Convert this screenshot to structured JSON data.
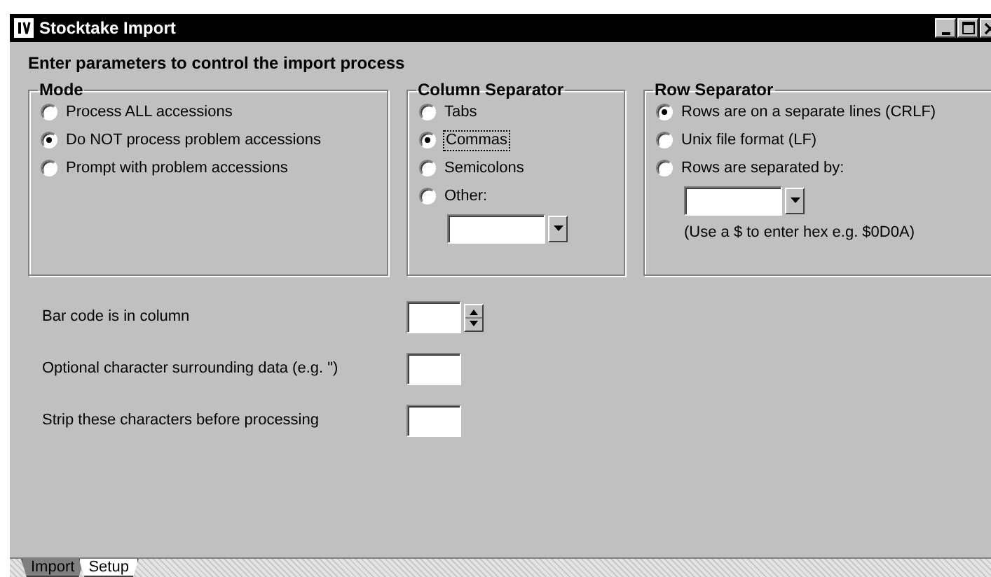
{
  "window": {
    "title": "Stocktake Import"
  },
  "heading": "Enter parameters to control the import process",
  "groups": [
    {
      "title": "Mode",
      "options": [
        {
          "label": "Process ALL accessions",
          "selected": false,
          "focused": false
        },
        {
          "label": "Do NOT process problem accessions",
          "selected": true,
          "focused": false
        },
        {
          "label": "Prompt with problem accessions",
          "selected": false,
          "focused": false
        }
      ],
      "combo_after": false
    },
    {
      "title": "Column Separator",
      "options": [
        {
          "label": "Tabs",
          "selected": false,
          "focused": false
        },
        {
          "label": "Commas",
          "selected": true,
          "focused": true
        },
        {
          "label": "Semicolons",
          "selected": false,
          "focused": false
        },
        {
          "label": "Other:",
          "selected": false,
          "focused": false
        }
      ],
      "combo_after": true
    },
    {
      "title": "Row Separator",
      "options": [
        {
          "label": "Rows are on a separate lines (CRLF)",
          "selected": true,
          "focused": false
        },
        {
          "label": "Unix file format (LF)",
          "selected": false,
          "focused": false
        },
        {
          "label": "Rows are separated by:",
          "selected": false,
          "focused": false
        }
      ],
      "combo_after": true,
      "note": "(Use a $ to enter hex e.g. $0D0A)"
    }
  ],
  "fields": [
    {
      "label": "Bar code is in column",
      "kind": "spinner"
    },
    {
      "label": "Optional character surrounding data (e.g. \")",
      "kind": "text"
    },
    {
      "label": "Strip these characters before processing",
      "kind": "text"
    }
  ],
  "tabs": [
    {
      "label": "Import",
      "selected": false
    },
    {
      "label": "Setup",
      "selected": true
    }
  ]
}
